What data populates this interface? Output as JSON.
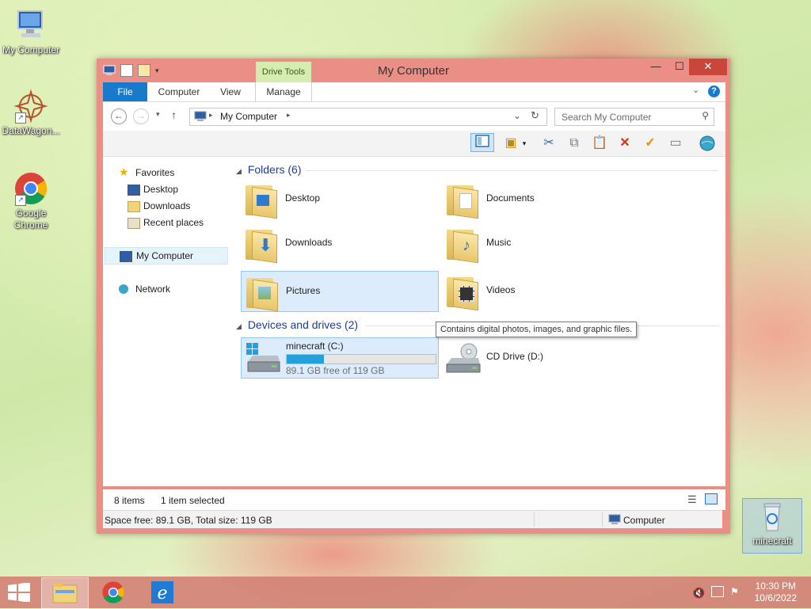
{
  "desktop": {
    "icons": [
      {
        "label": "My Computer"
      },
      {
        "label": "DataWagon..."
      },
      {
        "label": "Google Chrome"
      },
      {
        "label": "minecraft"
      }
    ]
  },
  "window": {
    "title": "My Computer",
    "contextual_tab": "Drive Tools",
    "tabs": [
      "File",
      "Computer",
      "View",
      "Manage"
    ],
    "address": {
      "crumb": "My Computer"
    },
    "search": {
      "placeholder": "Search My Computer"
    },
    "nav": {
      "favorites": "Favorites",
      "favorites_items": [
        "Desktop",
        "Downloads",
        "Recent places"
      ],
      "computer": "My Computer",
      "network": "Network"
    },
    "folders_header": "Folders (6)",
    "folders": [
      {
        "name": "Desktop"
      },
      {
        "name": "Documents"
      },
      {
        "name": "Downloads"
      },
      {
        "name": "Music"
      },
      {
        "name": "Pictures"
      },
      {
        "name": "Videos"
      }
    ],
    "devices_header": "Devices and drives (2)",
    "drives": [
      {
        "name": "minecraft (C:)",
        "free_text": "89.1 GB free of 119 GB",
        "used_fraction": 0.25
      },
      {
        "name": "CD Drive (D:)"
      }
    ],
    "tooltip": "Contains digital photos, images, and graphic files.",
    "status": {
      "items": "8 items",
      "selected": "1 item selected"
    },
    "info": {
      "space": "Space free: 89.1 GB, Total size: 119 GB",
      "location": "Computer"
    }
  },
  "taskbar": {
    "time": "10:30 PM",
    "date": "10/6/2022"
  },
  "colors": {
    "accent": "#1979ca",
    "title_bar": "#eb8f86",
    "close": "#c9473a",
    "drive_fill": "#26a0da"
  }
}
